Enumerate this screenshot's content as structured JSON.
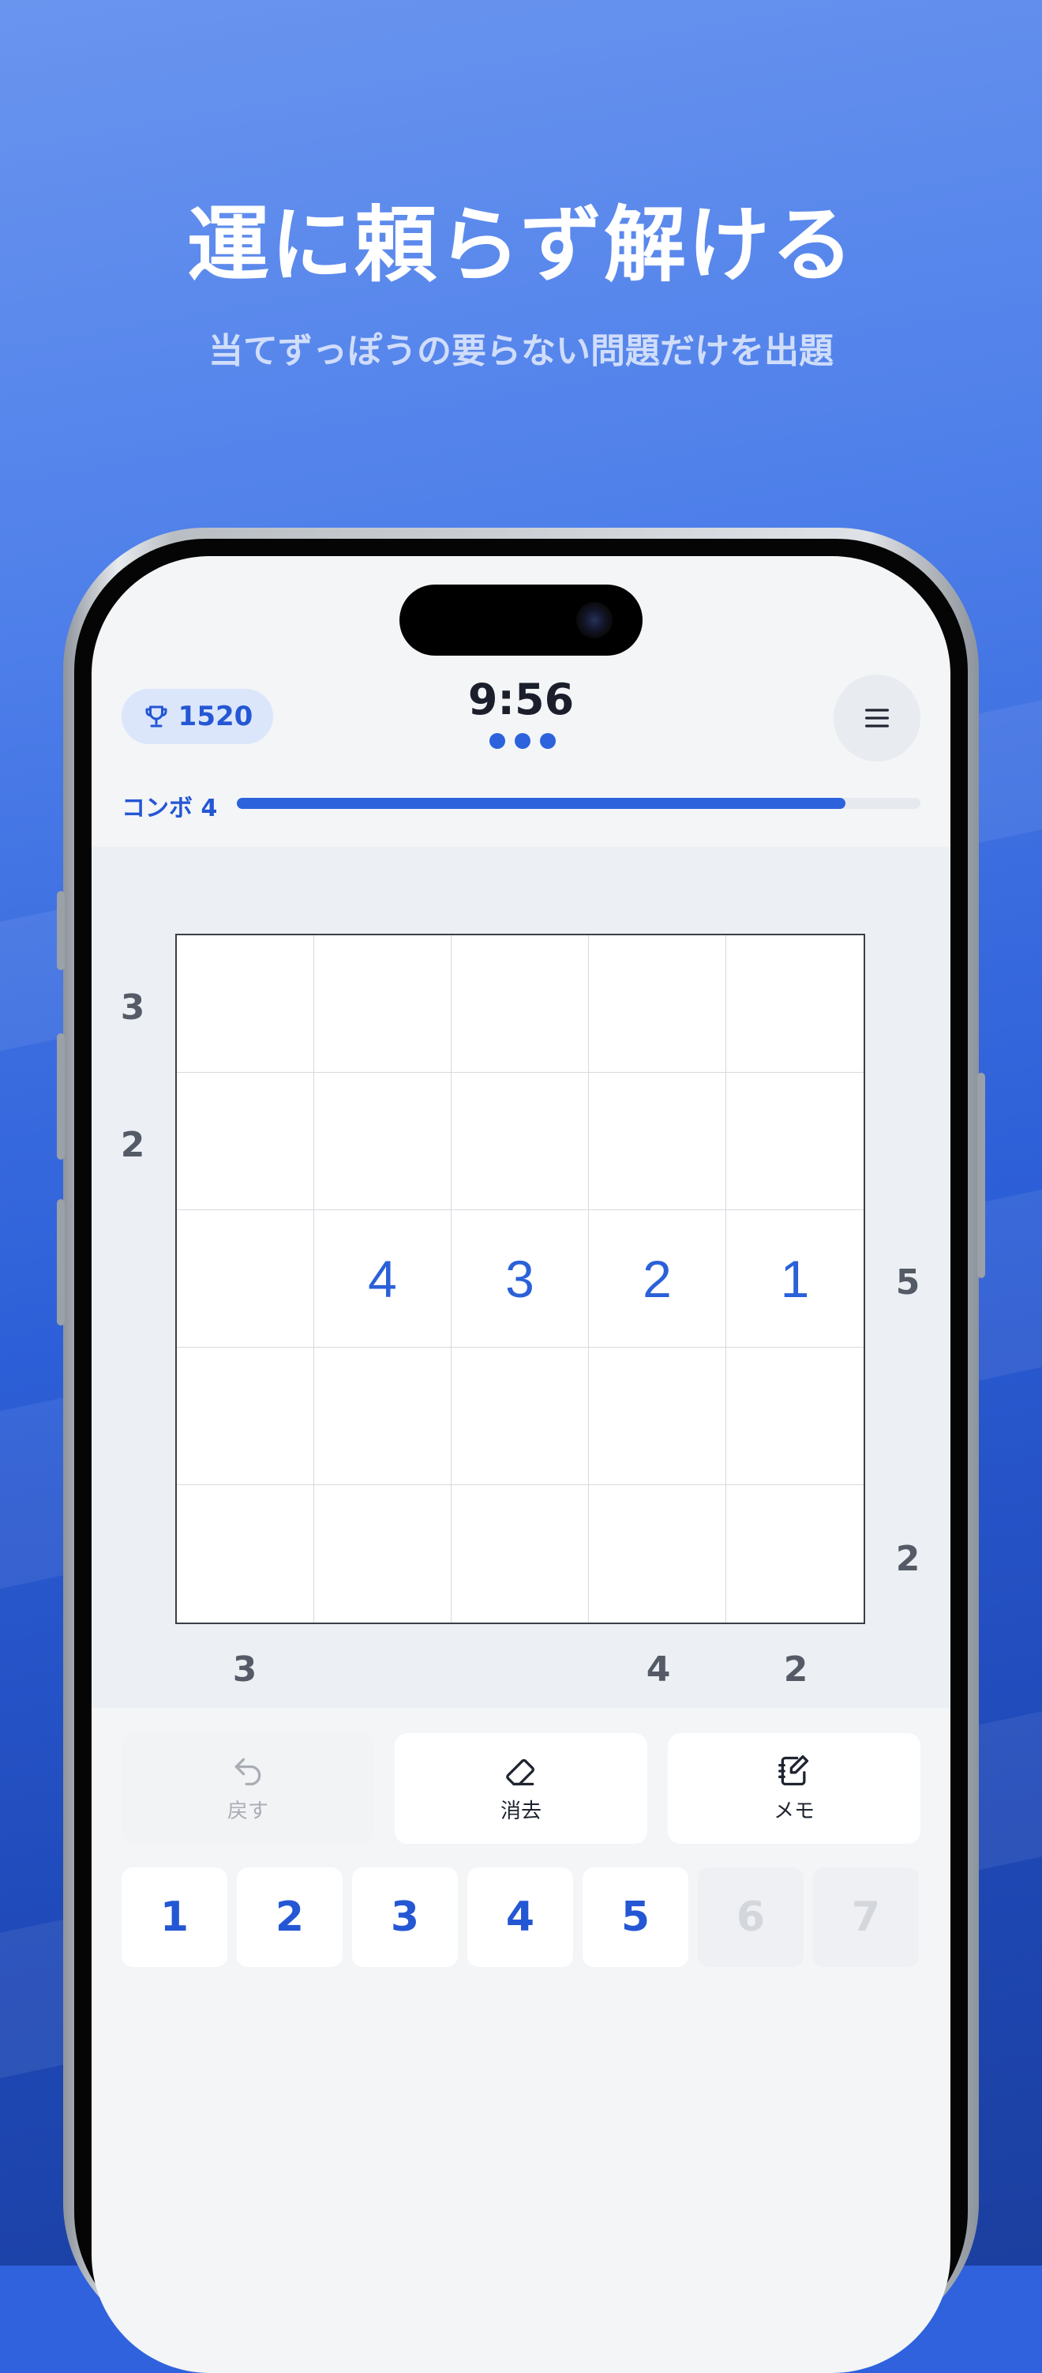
{
  "headline": "運に頼らず解ける",
  "subheadline": "当てずっぽうの要らない問題だけを出題",
  "header": {
    "trophy_icon": "trophy-icon",
    "score": "1520",
    "timer": "9:56",
    "menu_icon": "hamburger-menu-icon"
  },
  "combo": {
    "label": "コンボ 4",
    "progress": 0.89
  },
  "puzzle": {
    "size": 5,
    "cells": [
      [
        "",
        "",
        "",
        "",
        ""
      ],
      [
        "",
        "",
        "",
        "",
        ""
      ],
      [
        "",
        "4",
        "3",
        "2",
        "1"
      ],
      [
        "",
        "",
        "",
        "",
        ""
      ],
      [
        "",
        "",
        "",
        "",
        ""
      ]
    ],
    "clues_left": [
      "3",
      "2",
      "",
      "",
      ""
    ],
    "clues_right": [
      "",
      "",
      "5",
      "",
      "2"
    ],
    "clues_bottom": [
      "3",
      "",
      "",
      "4",
      "2"
    ]
  },
  "tools": {
    "undo_label": "戻す",
    "erase_label": "消去",
    "memo_label": "メモ"
  },
  "keypad": {
    "keys": [
      "1",
      "2",
      "3",
      "4",
      "5",
      "6",
      "7"
    ],
    "disabled": [
      "6",
      "7"
    ]
  },
  "colors": {
    "accent": "#2c62dc",
    "background": "#3a6ae0"
  }
}
